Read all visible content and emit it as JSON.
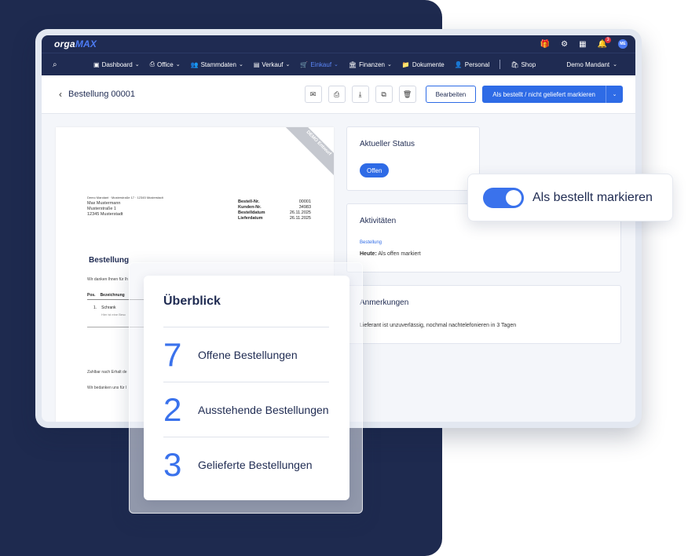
{
  "app": {
    "logo_prefix": "orga",
    "logo_suffix": "MAX"
  },
  "topbar": {
    "notification_count": "3",
    "avatar_initials": "ME"
  },
  "nav": {
    "items": [
      {
        "label": "Dashboard",
        "icon": "dashboard-icon"
      },
      {
        "label": "Office",
        "icon": "printer-icon"
      },
      {
        "label": "Stammdaten",
        "icon": "users-icon"
      },
      {
        "label": "Verkauf",
        "icon": "receipt-icon"
      },
      {
        "label": "Einkauf",
        "icon": "cart-icon",
        "active": true
      },
      {
        "label": "Finanzen",
        "icon": "bank-icon"
      },
      {
        "label": "Dokumente",
        "icon": "folder-icon"
      },
      {
        "label": "Personal",
        "icon": "person-icon"
      },
      {
        "label": "Shop",
        "icon": "shop-icon"
      }
    ],
    "mandant": "Demo Mandant",
    "active_color": "#5b86f7"
  },
  "header": {
    "title": "Bestellung 00001",
    "edit_label": "Bearbeiten",
    "primary_label": "Als bestellt / nicht geliefert markieren"
  },
  "document": {
    "ribbon": "DEMO Entwurf",
    "sender": "Demo Mandant · Musterstraße 17 · 12345 Musterstadt",
    "address": [
      "Max Mustermann",
      "Musterstraße 1",
      "12345 Musterstadt"
    ],
    "meta": [
      {
        "k": "Bestell-Nr.",
        "v": "00001"
      },
      {
        "k": "Kunden-Nr.",
        "v": "34983"
      },
      {
        "k": "Bestelldatum",
        "v": "26.11.2025"
      },
      {
        "k": "Lieferdatum",
        "v": "26.11.2025"
      }
    ],
    "heading": "Bestellung",
    "intro": "Wir danken Ihnen für Ih",
    "col_pos": "Pos.",
    "col_desc": "Bezeichnung",
    "item_pos": "1.",
    "item_name": "Schrank",
    "item_sub": "Hier ist eine Besc",
    "payment": "Zahlbar nach Erhalt de",
    "thanks": "Wir bedanken uns für I"
  },
  "status": {
    "title": "Aktueller Status",
    "value": "Offen"
  },
  "activities": {
    "title": "Aktivitäten",
    "label": "Bestellung",
    "date": "Heute:",
    "text": "Als offen markiert"
  },
  "notes": {
    "title": "Anmerkungen",
    "text": "Lieferant ist unzuverlässig, nochmal nachtelefonieren in 3 Tagen"
  },
  "toggle": {
    "label": "Als bestellt markieren",
    "on": true
  },
  "overview": {
    "title": "Überblick",
    "rows": [
      {
        "num": "7",
        "label": "Offene Bestellungen"
      },
      {
        "num": "2",
        "label": "Ausstehende Bestellungen"
      },
      {
        "num": "3",
        "label": "Gelieferte Bestellungen"
      }
    ]
  },
  "colors": {
    "navy": "#1e2a4f",
    "accent": "#2e6be6"
  }
}
